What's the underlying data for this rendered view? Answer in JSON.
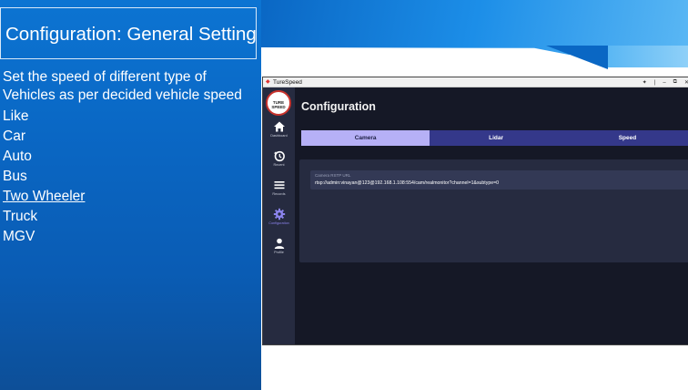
{
  "slide": {
    "title": "Configuration: General Setting",
    "description": "Set the speed of different type of Vehicles as per decided vehicle speed",
    "items": [
      "Like",
      "Car",
      "Auto",
      "Bus",
      "Two Wheeler",
      "Truck",
      "MGV"
    ]
  },
  "window": {
    "title": "TureSpeed",
    "controls": [
      "✦",
      "|",
      "–",
      "⧉",
      "✕"
    ]
  },
  "sidebar": {
    "logo_text": "TURE SPEED",
    "items": [
      {
        "label": "Dashboard",
        "icon": "home-icon"
      },
      {
        "label": "Recent",
        "icon": "history-icon"
      },
      {
        "label": "Records",
        "icon": "list-icon"
      },
      {
        "label": "Configuration",
        "icon": "gear-icon",
        "active": true
      },
      {
        "label": "Profile",
        "icon": "user-icon"
      }
    ]
  },
  "main": {
    "title": "Configuration",
    "tabs": [
      {
        "label": "Camera",
        "active": true
      },
      {
        "label": "Lidar"
      },
      {
        "label": "Speed"
      }
    ],
    "camera": {
      "field_label": "Camera RSTP URL",
      "field_value": "rtsp://admin:vinayan@123@192.168.1.108:554/cam/realmonitor?channel=1&subtype=0"
    }
  },
  "colors": {
    "slide_blue": "#0a67c4",
    "window_bg": "#151826",
    "sidebar_bg": "#262b40",
    "tab_bar": "#34388a",
    "tab_active": "#b6b0f6",
    "accent": "#8c84ee"
  }
}
